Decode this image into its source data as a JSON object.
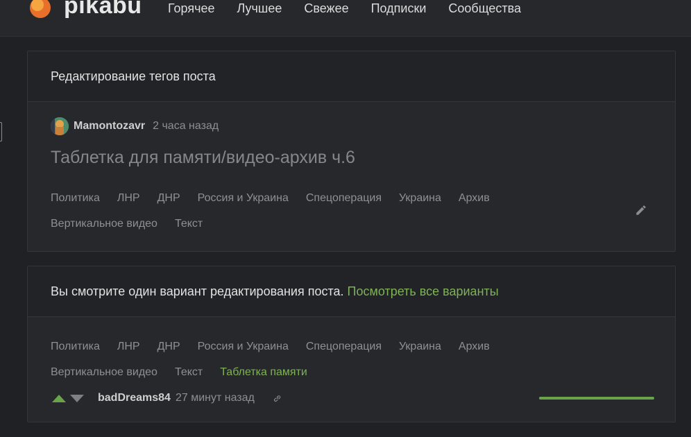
{
  "header": {
    "logo_text": "pikabu",
    "nav": [
      "Горячее",
      "Лучшее",
      "Свежее",
      "Подписки",
      "Сообщества"
    ]
  },
  "card1": {
    "title": "Редактирование тегов поста",
    "author": "Mamontozavr",
    "time": "2 часа назад",
    "post_title": "Таблетка для памяти/видео-архив ч.6",
    "tags": [
      "Политика",
      "ЛНР",
      "ДНР",
      "Россия и Украина",
      "Спецоперация",
      "Украина",
      "Архив",
      "Вертикальное видео",
      "Текст"
    ]
  },
  "card2": {
    "notice": "Вы смотрите один вариант редактирования поста.",
    "notice_link": "Посмотреть все варианты",
    "tags": [
      "Политика",
      "ЛНР",
      "ДНР",
      "Россия и Украина",
      "Спецоперация",
      "Украина",
      "Архив",
      "Вертикальное видео",
      "Текст"
    ],
    "new_tag": "Таблетка памяти",
    "editor": "badDreams84",
    "time": "27 минут назад",
    "rating_fraction": 1.0
  },
  "colors": {
    "background": "#1f2124",
    "card": "#26282b",
    "accent_green": "#7fb255",
    "vote_up": "#6aa44a"
  },
  "icons": [
    "logo-icon",
    "edit-pencil-icon",
    "vote-up-icon",
    "vote-down-icon",
    "link-icon"
  ]
}
